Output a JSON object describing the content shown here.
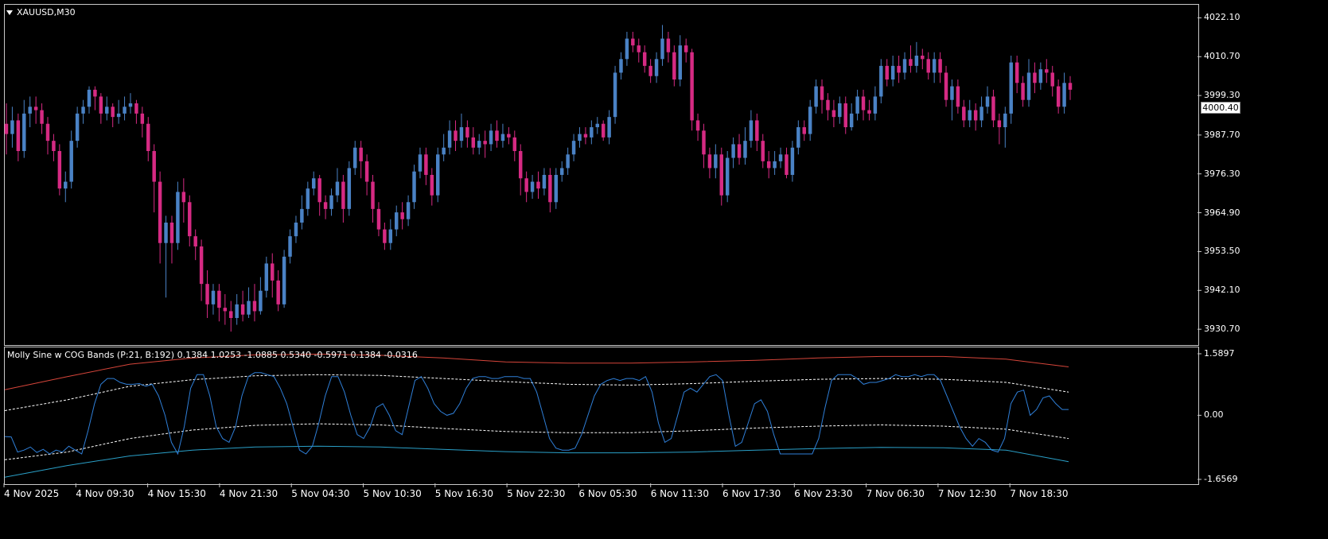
{
  "symbol_title": "XAUUSD,M30",
  "indicator_label": "Molly Sine w COG Bands (P:21, B:192) 0.1384 1.0253 -1.0885 0.5340 -0.5971 0.1384 -0.0316",
  "current_price": "4000.40",
  "colors": {
    "bull": "#4a82c5",
    "bear": "#d62a83",
    "sine": "#2f7fd8",
    "upper_band": "#d6453a",
    "lower_band": "#2aa0c8",
    "inner_band": "#ffffff",
    "frame": "#c8c8c8"
  },
  "price_axis": {
    "labels": [
      "4022.10",
      "4010.70",
      "3999.30",
      "3987.70",
      "3976.30",
      "3964.90",
      "3953.50",
      "3942.10",
      "3930.70"
    ],
    "range": [
      3927.0,
      4025.0
    ]
  },
  "indicator_axis": {
    "labels": [
      "1.5897",
      "0.00",
      "-1.6569"
    ],
    "range": [
      -1.6569,
      1.5897
    ]
  },
  "time_axis": {
    "labels": [
      "4 Nov 2025",
      "4 Nov 09:30",
      "4 Nov 15:30",
      "4 Nov 21:30",
      "5 Nov 04:30",
      "5 Nov 10:30",
      "5 Nov 16:30",
      "5 Nov 22:30",
      "6 Nov 05:30",
      "6 Nov 11:30",
      "6 Nov 17:30",
      "6 Nov 23:30",
      "7 Nov 06:30",
      "7 Nov 12:30",
      "7 Nov 18:30"
    ]
  },
  "chart_data": {
    "type": "candlestick",
    "candles": [
      [
        3991,
        3988,
        3997,
        3982
      ],
      [
        3988,
        3992,
        3996,
        3984
      ],
      [
        3992,
        3983,
        3994,
        3980
      ],
      [
        3983,
        3994,
        3998,
        3981
      ],
      [
        3994,
        3996,
        3999,
        3990
      ],
      [
        3996,
        3995,
        3999,
        3991
      ],
      [
        3995,
        3991,
        3997,
        3988
      ],
      [
        3991,
        3986,
        3993,
        3982
      ],
      [
        3986,
        3983,
        3988,
        3980
      ],
      [
        3983,
        3972,
        3985,
        3970
      ],
      [
        3972,
        3974,
        3977,
        3968
      ],
      [
        3974,
        3986,
        3989,
        3972
      ],
      [
        3986,
        3994,
        3996,
        3984
      ],
      [
        3994,
        3996,
        3998,
        3991
      ],
      [
        3996,
        4001,
        4002,
        3994
      ],
      [
        4001,
        3999,
        4002,
        3995
      ],
      [
        3999,
        3994,
        4000,
        3991
      ],
      [
        3994,
        3996,
        3999,
        3992
      ],
      [
        3996,
        3993,
        3997,
        3990
      ],
      [
        3993,
        3994,
        3998,
        3991
      ],
      [
        3994,
        3996,
        3999,
        3992
      ],
      [
        3996,
        3997,
        4000,
        3994
      ],
      [
        3997,
        3994,
        3998,
        3991
      ],
      [
        3994,
        3991,
        3996,
        3987
      ],
      [
        3991,
        3983,
        3993,
        3980
      ],
      [
        3983,
        3974,
        3985,
        3965
      ],
      [
        3974,
        3956,
        3977,
        3950
      ],
      [
        3956,
        3962,
        3964,
        3940
      ],
      [
        3962,
        3956,
        3964,
        3950
      ],
      [
        3956,
        3971,
        3974,
        3954
      ],
      [
        3971,
        3968,
        3975,
        3962
      ],
      [
        3968,
        3958,
        3970,
        3955
      ],
      [
        3958,
        3955,
        3960,
        3951
      ],
      [
        3955,
        3944,
        3957,
        3939
      ],
      [
        3944,
        3938,
        3948,
        3934
      ],
      [
        3938,
        3942,
        3944,
        3935
      ],
      [
        3942,
        3937,
        3944,
        3933
      ],
      [
        3937,
        3936,
        3941,
        3932
      ],
      [
        3936,
        3934,
        3939,
        3930
      ],
      [
        3934,
        3938,
        3941,
        3932
      ],
      [
        3938,
        3935,
        3942,
        3933
      ],
      [
        3935,
        3939,
        3943,
        3934
      ],
      [
        3939,
        3936,
        3944,
        3933
      ],
      [
        3936,
        3942,
        3946,
        3935
      ],
      [
        3942,
        3950,
        3952,
        3940
      ],
      [
        3950,
        3945,
        3953,
        3940
      ],
      [
        3945,
        3938,
        3948,
        3936
      ],
      [
        3938,
        3952,
        3954,
        3937
      ],
      [
        3952,
        3958,
        3960,
        3950
      ],
      [
        3958,
        3962,
        3964,
        3956
      ],
      [
        3962,
        3966,
        3970,
        3960
      ],
      [
        3966,
        3972,
        3974,
        3964
      ],
      [
        3972,
        3975,
        3977,
        3970
      ],
      [
        3975,
        3968,
        3976,
        3964
      ],
      [
        3968,
        3966,
        3970,
        3963
      ],
      [
        3966,
        3970,
        3972,
        3964
      ],
      [
        3970,
        3974,
        3978,
        3968
      ],
      [
        3974,
        3966,
        3976,
        3962
      ],
      [
        3966,
        3978,
        3980,
        3964
      ],
      [
        3978,
        3984,
        3986,
        3976
      ],
      [
        3984,
        3980,
        3986,
        3975
      ],
      [
        3980,
        3974,
        3982,
        3970
      ],
      [
        3974,
        3966,
        3976,
        3962
      ],
      [
        3966,
        3960,
        3968,
        3958
      ],
      [
        3960,
        3956,
        3962,
        3954
      ],
      [
        3956,
        3960,
        3963,
        3954
      ],
      [
        3960,
        3965,
        3967,
        3958
      ],
      [
        3965,
        3963,
        3968,
        3960
      ],
      [
        3963,
        3968,
        3970,
        3961
      ],
      [
        3968,
        3977,
        3979,
        3966
      ],
      [
        3977,
        3982,
        3984,
        3975
      ],
      [
        3982,
        3976,
        3984,
        3973
      ],
      [
        3976,
        3970,
        3978,
        3967
      ],
      [
        3970,
        3982,
        3984,
        3968
      ],
      [
        3982,
        3984,
        3988,
        3980
      ],
      [
        3984,
        3989,
        3992,
        3982
      ],
      [
        3989,
        3986,
        3992,
        3983
      ],
      [
        3986,
        3990,
        3994,
        3984
      ],
      [
        3990,
        3987,
        3992,
        3984
      ],
      [
        3987,
        3984,
        3990,
        3982
      ],
      [
        3984,
        3986,
        3988,
        3982
      ],
      [
        3986,
        3985,
        3989,
        3981
      ],
      [
        3985,
        3989,
        3991,
        3983
      ],
      [
        3989,
        3986,
        3992,
        3984
      ],
      [
        3986,
        3988,
        3991,
        3984
      ],
      [
        3988,
        3987,
        3990,
        3985
      ],
      [
        3987,
        3983,
        3989,
        3980
      ],
      [
        3983,
        3975,
        3985,
        3970
      ],
      [
        3975,
        3971,
        3977,
        3968
      ],
      [
        3971,
        3974,
        3976,
        3969
      ],
      [
        3974,
        3972,
        3977,
        3969
      ],
      [
        3972,
        3976,
        3978,
        3970
      ],
      [
        3976,
        3968,
        3978,
        3965
      ],
      [
        3968,
        3976,
        3978,
        3966
      ],
      [
        3976,
        3978,
        3980,
        3974
      ],
      [
        3978,
        3982,
        3984,
        3976
      ],
      [
        3982,
        3986,
        3988,
        3980
      ],
      [
        3986,
        3988,
        3990,
        3984
      ],
      [
        3988,
        3987,
        3990,
        3985
      ],
      [
        3987,
        3990,
        3992,
        3985
      ],
      [
        3990,
        3991,
        3993,
        3988
      ],
      [
        3991,
        3987,
        3992,
        3986
      ],
      [
        3987,
        3993,
        3995,
        3985
      ],
      [
        3993,
        4006,
        4008,
        3991
      ],
      [
        4006,
        4010,
        4012,
        4004
      ],
      [
        4010,
        4016,
        4018,
        4008
      ],
      [
        4016,
        4014,
        4018,
        4012
      ],
      [
        4014,
        4012,
        4016,
        4009
      ],
      [
        4012,
        4008,
        4014,
        4006
      ],
      [
        4008,
        4005,
        4010,
        4003
      ],
      [
        4005,
        4010,
        4012,
        4003
      ],
      [
        4010,
        4016,
        4020,
        4008
      ],
      [
        4016,
        4012,
        4018,
        4009
      ],
      [
        4012,
        4004,
        4014,
        4002
      ],
      [
        4004,
        4014,
        4017,
        4002
      ],
      [
        4014,
        4012,
        4016,
        4009
      ],
      [
        4012,
        3992,
        4013,
        3989
      ],
      [
        3992,
        3989,
        3994,
        3986
      ],
      [
        3989,
        3982,
        3991,
        3978
      ],
      [
        3982,
        3978,
        3984,
        3975
      ],
      [
        3978,
        3982,
        3985,
        3975
      ],
      [
        3982,
        3970,
        3984,
        3967
      ],
      [
        3970,
        3981,
        3983,
        3968
      ],
      [
        3981,
        3985,
        3987,
        3978
      ],
      [
        3985,
        3981,
        3988,
        3979
      ],
      [
        3981,
        3986,
        3990,
        3979
      ],
      [
        3986,
        3992,
        3995,
        3984
      ],
      [
        3992,
        3986,
        3994,
        3983
      ],
      [
        3986,
        3980,
        3988,
        3978
      ],
      [
        3980,
        3978,
        3983,
        3975
      ],
      [
        3978,
        3980,
        3983,
        3976
      ],
      [
        3980,
        3982,
        3984,
        3978
      ],
      [
        3982,
        3976,
        3984,
        3975
      ],
      [
        3976,
        3984,
        3986,
        3974
      ],
      [
        3984,
        3990,
        3992,
        3982
      ],
      [
        3990,
        3988,
        3992,
        3986
      ],
      [
        3988,
        3996,
        3998,
        3986
      ],
      [
        3996,
        4002,
        4004,
        3994
      ],
      [
        4002,
        3998,
        4004,
        3994
      ],
      [
        3998,
        3995,
        4000,
        3992
      ],
      [
        3995,
        3993,
        3998,
        3990
      ],
      [
        3993,
        3997,
        3999,
        3991
      ],
      [
        3997,
        3990,
        3999,
        3988
      ],
      [
        3990,
        3994,
        3997,
        3989
      ],
      [
        3994,
        3999,
        4001,
        3992
      ],
      [
        3999,
        3995,
        4001,
        3992
      ],
      [
        3995,
        3994,
        3998,
        3992
      ],
      [
        3994,
        3999,
        4002,
        3992
      ],
      [
        3999,
        4008,
        4010,
        3997
      ],
      [
        4008,
        4004,
        4010,
        4002
      ],
      [
        4004,
        4008,
        4011,
        4002
      ],
      [
        4008,
        4006,
        4011,
        4003
      ],
      [
        4006,
        4010,
        4012,
        4004
      ],
      [
        4010,
        4008,
        4014,
        4006
      ],
      [
        4008,
        4011,
        4015,
        4006
      ],
      [
        4011,
        4010,
        4013,
        4007
      ],
      [
        4010,
        4006,
        4012,
        4004
      ],
      [
        4006,
        4010,
        4012,
        4003
      ],
      [
        4010,
        4006,
        4012,
        4003
      ],
      [
        4006,
        3998,
        4008,
        3996
      ],
      [
        3998,
        4002,
        4004,
        3992
      ],
      [
        4002,
        3996,
        4004,
        3994
      ],
      [
        3996,
        3992,
        3998,
        3990
      ],
      [
        3992,
        3995,
        3998,
        3990
      ],
      [
        3995,
        3992,
        3997,
        3989
      ],
      [
        3992,
        3996,
        3999,
        3990
      ],
      [
        3996,
        3999,
        4002,
        3994
      ],
      [
        3999,
        3992,
        4001,
        3990
      ],
      [
        3992,
        3990,
        3994,
        3985
      ],
      [
        3990,
        3994,
        3996,
        3984
      ],
      [
        3994,
        4009,
        4011,
        3991
      ],
      [
        4009,
        4003,
        4011,
        4000
      ],
      [
        4003,
        3998,
        4005,
        3996
      ],
      [
        3998,
        4006,
        4010,
        3996
      ],
      [
        4006,
        4003,
        4009,
        4000
      ],
      [
        4003,
        4007,
        4009,
        4001
      ],
      [
        4007,
        4006,
        4010,
        4003
      ],
      [
        4006,
        4002,
        4008,
        3999
      ],
      [
        4002,
        3996,
        4004,
        3994
      ],
      [
        3996,
        4003,
        4006,
        3994
      ],
      [
        4003,
        4001,
        4005,
        3998
      ]
    ],
    "sine": [
      -0.55,
      -0.56,
      -0.95,
      -0.9,
      -0.82,
      -0.96,
      -0.88,
      -1.0,
      -0.9,
      -0.95,
      -0.8,
      -0.9,
      -1.0,
      -0.4,
      0.3,
      0.8,
      0.95,
      0.95,
      0.85,
      0.8,
      0.8,
      0.82,
      0.75,
      0.8,
      0.5,
      0.0,
      -0.7,
      -1.0,
      -0.3,
      0.7,
      1.05,
      1.05,
      0.5,
      -0.3,
      -0.6,
      -0.7,
      -0.3,
      0.5,
      1.0,
      1.1,
      1.1,
      1.05,
      1.0,
      0.7,
      0.3,
      -0.3,
      -0.9,
      -1.0,
      -0.8,
      -0.2,
      0.5,
      1.0,
      1.0,
      0.6,
      0.0,
      -0.5,
      -0.6,
      -0.3,
      0.2,
      0.3,
      0.0,
      -0.4,
      -0.5,
      0.2,
      0.9,
      1.0,
      0.7,
      0.3,
      0.1,
      0.0,
      0.05,
      0.3,
      0.7,
      0.95,
      1.0,
      1.0,
      0.95,
      0.95,
      1.0,
      1.0,
      1.0,
      0.95,
      0.95,
      0.6,
      0.0,
      -0.6,
      -0.85,
      -0.9,
      -0.9,
      -0.85,
      -0.5,
      0.0,
      0.5,
      0.8,
      0.9,
      0.95,
      0.9,
      0.95,
      0.95,
      0.9,
      1.0,
      0.6,
      -0.2,
      -0.7,
      -0.6,
      0.0,
      0.6,
      0.7,
      0.6,
      0.8,
      1.0,
      1.05,
      0.9,
      0.0,
      -0.8,
      -0.7,
      -0.2,
      0.3,
      0.4,
      0.1,
      -0.5,
      -1.0,
      -1.0,
      -1.0,
      -1.0,
      -1.0,
      -1.0,
      -0.6,
      0.2,
      0.9,
      1.05,
      1.05,
      1.05,
      0.95,
      0.8,
      0.85,
      0.85,
      0.9,
      0.95,
      1.05,
      1.0,
      1.0,
      1.05,
      1.0,
      1.05,
      1.05,
      0.9,
      0.5,
      0.1,
      -0.3,
      -0.6,
      -0.8,
      -0.6,
      -0.7,
      -0.9,
      -0.95,
      -0.6,
      0.3,
      0.6,
      0.65,
      0.0,
      0.15,
      0.45,
      0.5,
      0.3,
      0.15,
      0.15
    ],
    "upper_band": [
      0.66,
      1.0,
      1.32,
      1.48,
      1.56,
      1.58,
      1.55,
      1.48,
      1.38,
      1.35,
      1.35,
      1.38,
      1.42,
      1.48,
      1.52,
      1.52,
      1.45,
      1.25
    ],
    "inner_upper": [
      0.12,
      0.4,
      0.75,
      0.92,
      1.02,
      1.05,
      1.03,
      0.95,
      0.87,
      0.8,
      0.78,
      0.82,
      0.88,
      0.93,
      0.95,
      0.93,
      0.85,
      0.6
    ],
    "inner_lower": [
      -1.15,
      -0.95,
      -0.6,
      -0.38,
      -0.26,
      -0.22,
      -0.25,
      -0.34,
      -0.42,
      -0.45,
      -0.45,
      -0.4,
      -0.33,
      -0.28,
      -0.25,
      -0.28,
      -0.36,
      -0.6
    ],
    "lower_band": [
      -1.6,
      -1.3,
      -1.05,
      -0.9,
      -0.82,
      -0.8,
      -0.82,
      -0.88,
      -0.94,
      -0.97,
      -0.97,
      -0.95,
      -0.9,
      -0.86,
      -0.83,
      -0.84,
      -0.9,
      -1.2
    ]
  }
}
